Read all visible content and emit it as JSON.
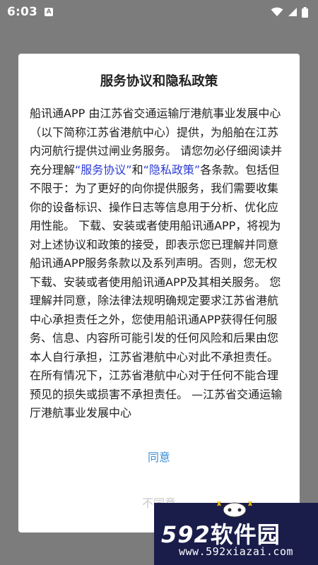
{
  "status_bar": {
    "time": "6:03",
    "app_icon_letter": "A"
  },
  "dialog": {
    "title": "服务协议和隐私政策",
    "body": {
      "part1": "船讯通APP 由江苏省交通运输厅港航事业发展中心（以下简称江苏省港航中心）提供，为船舶在江苏内河航行提供过闸业务服务。 请您勿必仔细阅读并充分理解",
      "link_service": "“服务协议”",
      "and": "和",
      "link_privacy": "“隐私政策”",
      "part2": "各条款。包括但不限于：为了更好的向你提供服务，我们需要收集你的设备标识、操作日志等信息用于分析、优化应用性能。 下载、安装或者使用船讯通APP，将视为对上述协议和政策的接受，即表示您已理解并同意船讯通APP服务条款以及系列声明。否则，您无权下载、安装或者使用船讯通APP及其相关服务。 您理解并同意，除法律法规明确规定要求江苏省港航中心承担责任之外，您使用船讯通APP获得任何服务、信息、内容所可能引发的任何风险和后果由您本人自行承担，江苏省港航中心对此不承担责任。在所有情况下，江苏省港航中心对于任何不能合理预见的损失或损害不承担责任。 —江苏省交通运输厅港航事业发展中心"
    },
    "agree_label": "同意",
    "disagree_label": "不同意"
  },
  "watermark": {
    "brand_number": "592",
    "brand_text": "软件园",
    "url": "www.592xiazai.com"
  },
  "colors": {
    "overlay": "#7c7c7c",
    "link": "#2c3bd6",
    "agree": "#3b8fd8",
    "disagree": "#c9c9c9"
  }
}
